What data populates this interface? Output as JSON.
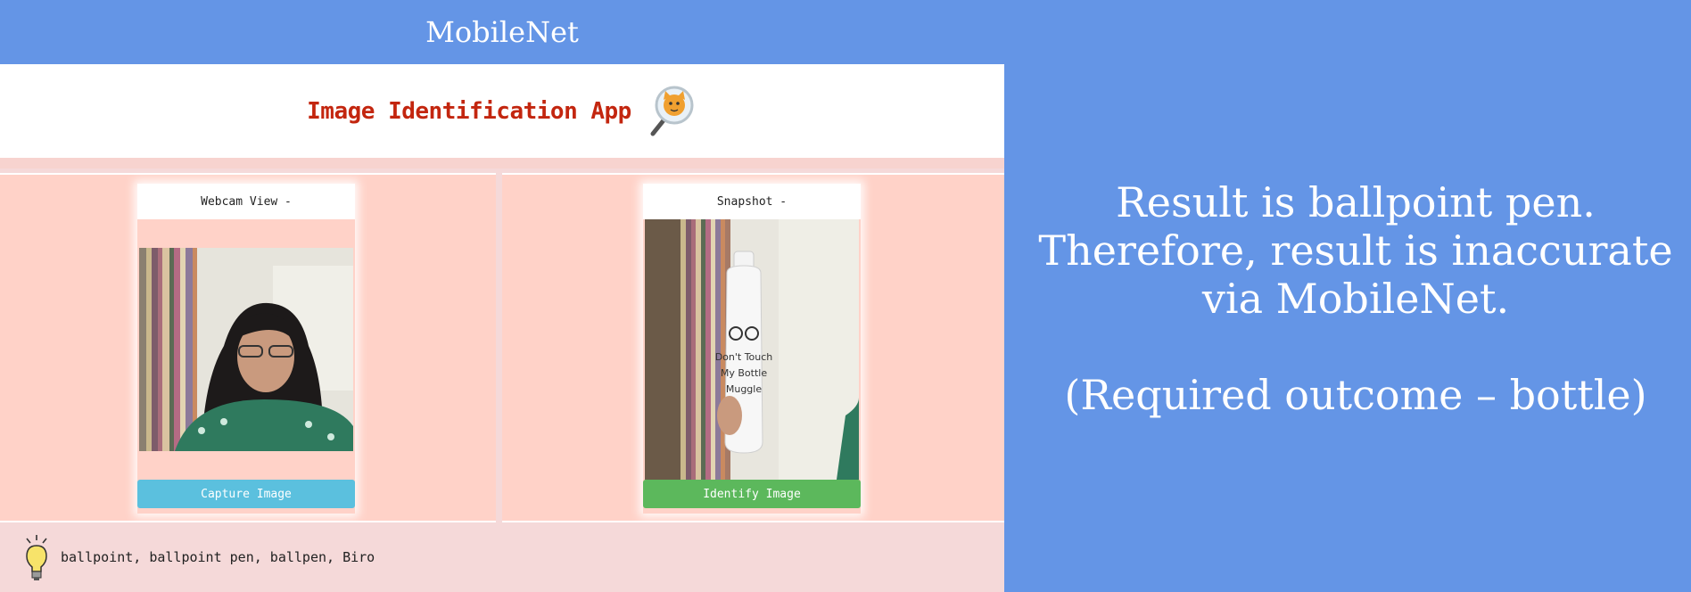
{
  "window_title": "MobileNet",
  "app": {
    "title": "Image Identification App",
    "header_icon": "magnifier-cat-icon",
    "webcam": {
      "heading": "Webcam View -",
      "button_label": "Capture Image",
      "button_color": "#5bc0de"
    },
    "snapshot": {
      "heading": "Snapshot -",
      "button_label": "Identify Image",
      "button_color": "#5cb85c"
    },
    "result": {
      "icon": "lightbulb-icon",
      "text": "ballpoint, ballpoint pen, ballpen, Biro"
    }
  },
  "caption": {
    "line1": "Result is ballpoint pen.",
    "line2": "Therefore, result is inaccurate",
    "line3": "via MobileNet.",
    "line4": "(Required outcome – bottle)"
  },
  "colors": {
    "background": "#6495e6",
    "panel": "#ffd2c8",
    "title_red": "#c3260f"
  }
}
